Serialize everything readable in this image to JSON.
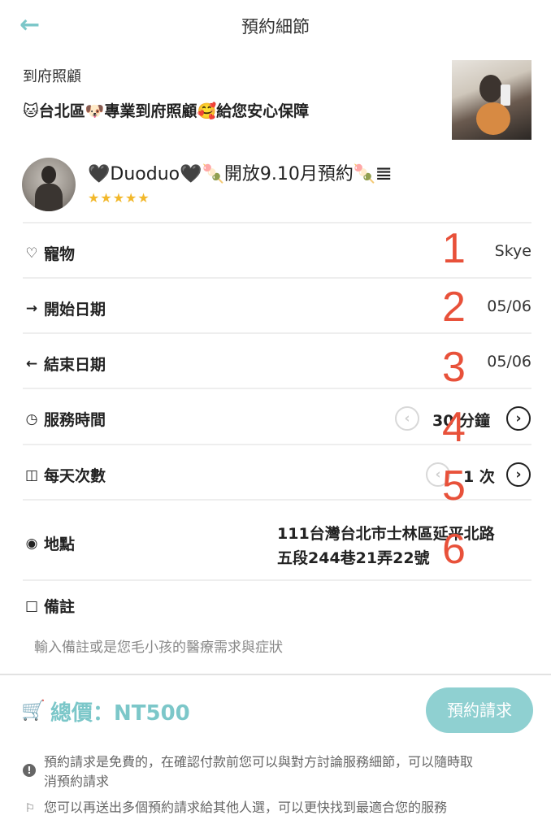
{
  "header": {
    "title": "預約細節",
    "back_icon": "arrow-left-icon"
  },
  "service": {
    "type_label": "到府照顧",
    "title": "🐱台北區🐶專業到府照顧🥰給您安心保障"
  },
  "sitter": {
    "name": "🖤Duoduo🖤🍡開放9.10月預約🍡𝌆",
    "stars": "★★★★★",
    "rating": 5
  },
  "rows": {
    "pet": {
      "label": "寵物",
      "value": "Skye",
      "icon": "heart-icon"
    },
    "start_date": {
      "label": "開始日期",
      "value": "05/06",
      "icon": "arrow-right-icon"
    },
    "end_date": {
      "label": "結束日期",
      "value": "05/06",
      "icon": "arrow-left-icon"
    },
    "duration": {
      "label": "服務時間",
      "value": "30 分鐘",
      "icon": "clock-icon"
    },
    "frequency": {
      "label": "每天次數",
      "value": "1 次",
      "icon": "calendar-icon"
    },
    "location": {
      "label": "地點",
      "value_line1": "111台灣台北市士林區延平北路",
      "value_line2": "五段244巷21弄22號",
      "icon": "map-pin-icon"
    },
    "notes": {
      "label": "備註",
      "placeholder": "輸入備註或是您毛小孩的醫療需求與症狀",
      "icon": "note-icon"
    }
  },
  "annotations": [
    "1",
    "2",
    "3",
    "4",
    "5",
    "6"
  ],
  "footer": {
    "total": "總價：NT500",
    "request_button": "預約請求",
    "tip1": "預約請求是免費的，在確認付款前您可以與對方討論服務細節，可以隨時取",
    "tip1_line2": "消預約請求",
    "tip2": "您可以再送出多個預約請求給其他人選，可以更快找到最適合您的服務"
  },
  "colors": {
    "accent": "#7cc7c9",
    "annotation": "#e8513a",
    "stars": "#f2b82b"
  }
}
